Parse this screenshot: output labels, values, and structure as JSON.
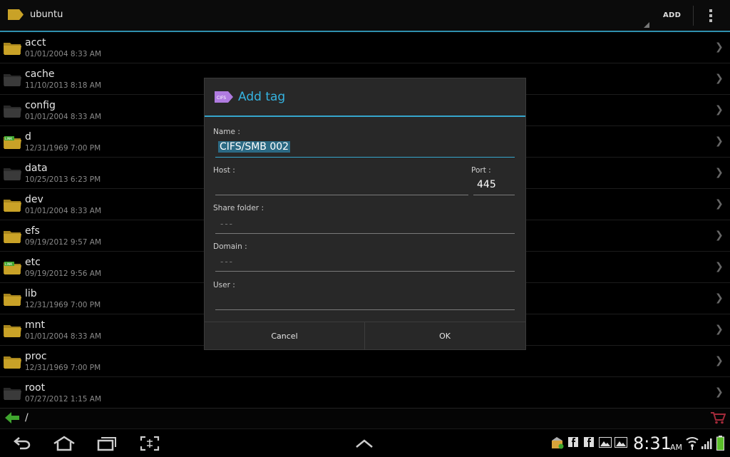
{
  "actionbar": {
    "title": "ubuntu",
    "add_label": "ADD"
  },
  "files": [
    {
      "name": "acct",
      "date": "01/01/2004 8:33 AM",
      "kind": "folder"
    },
    {
      "name": "cache",
      "date": "11/10/2013 8:18 AM",
      "kind": "folder-dark"
    },
    {
      "name": "config",
      "date": "01/01/2004 8:33 AM",
      "kind": "folder-dark"
    },
    {
      "name": "d",
      "date": "12/31/1969 7:00 PM",
      "kind": "link",
      "link_label": "LINK"
    },
    {
      "name": "data",
      "date": "10/25/2013 6:23 PM",
      "kind": "folder-dark"
    },
    {
      "name": "dev",
      "date": "01/01/2004 8:33 AM",
      "kind": "folder"
    },
    {
      "name": "efs",
      "date": "09/19/2012 9:57 AM",
      "kind": "folder"
    },
    {
      "name": "etc",
      "date": "09/19/2012 9:56 AM",
      "kind": "link",
      "link_label": "LINK"
    },
    {
      "name": "lib",
      "date": "12/31/1969 7:00 PM",
      "kind": "folder"
    },
    {
      "name": "mnt",
      "date": "01/01/2004 8:33 AM",
      "kind": "folder"
    },
    {
      "name": "proc",
      "date": "12/31/1969 7:00 PM",
      "kind": "folder"
    },
    {
      "name": "root",
      "date": "07/27/2012 1:15 AM",
      "kind": "folder-dark"
    }
  ],
  "path": {
    "current": "/"
  },
  "dialog": {
    "icon_text": "CIFS",
    "title": "Add tag",
    "name_label": "Name :",
    "name_value": "CIFS/SMB 002",
    "host_label": "Host :",
    "host_value": "",
    "port_label": "Port :",
    "port_value": "445",
    "share_label": "Share folder :",
    "share_placeholder": "---",
    "domain_label": "Domain :",
    "domain_placeholder": "---",
    "user_label": "User :",
    "user_value": "",
    "cancel_label": "Cancel",
    "ok_label": "OK"
  },
  "statusbar": {
    "time": "8:31",
    "ampm": "AM"
  },
  "colors": {
    "accent": "#35a6cc",
    "folder": "#c9a227",
    "link_green": "#3fa52e"
  }
}
